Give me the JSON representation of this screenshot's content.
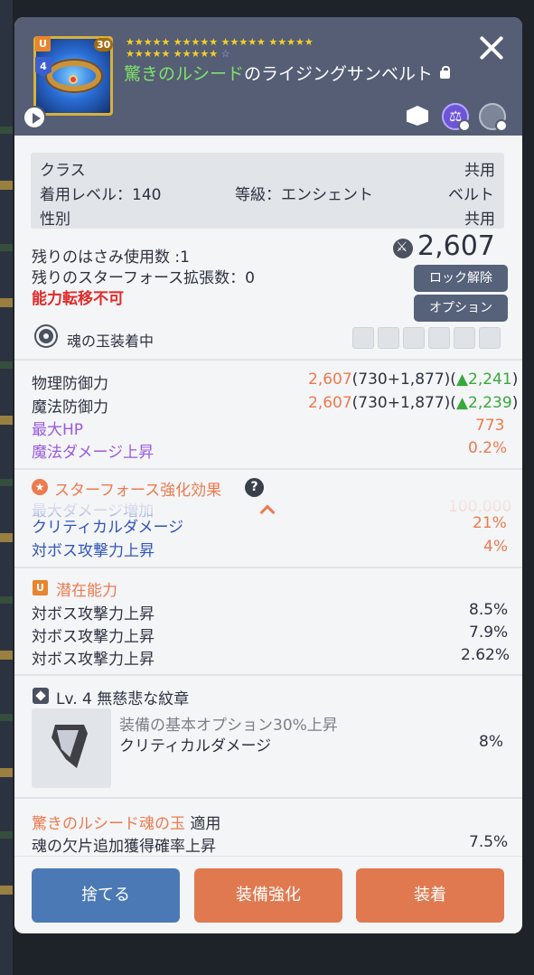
{
  "item": {
    "title_prefix": "驚きのルシード",
    "title_suffix": "のライジングサンベルト",
    "stars_filled": "★★★★★ ★★★★★ ★★★★★ ★★★★★",
    "stars_row2": "★★★★★ ★★★★★",
    "star_empty": "☆",
    "badge_rank": "U",
    "badge_level": "4",
    "badge_count": "30"
  },
  "info": {
    "class_label": "クラス",
    "class_value": "共用",
    "level_label": "着用レベル：140",
    "grade_label": "等級：エンシェント",
    "type_value": "ベルト",
    "gender_label": "性別",
    "gender_value": "共用"
  },
  "status": {
    "scissors": "残りのはさみ使用数 :1",
    "starforce_ext": "残りのスターフォース拡張数：0",
    "transfer": "能力転移不可",
    "attack_power": "2,607",
    "unlock_btn": "ロック解除",
    "option_btn": "オプション",
    "soul_equipped": "魂の玉装着中"
  },
  "stats": [
    {
      "name": "物理防御力",
      "value": "2,607",
      "detail": "(730+1,877)(",
      "up": "▲2,241",
      "close": ")",
      "style": "normal"
    },
    {
      "name": "魔法防御力",
      "value": "2,607",
      "detail": "(730+1,877)(",
      "up": "▲2,239",
      "close": ")",
      "style": "normal"
    },
    {
      "name": "最大HP",
      "value": "773",
      "style": "purple"
    },
    {
      "name": "魔法ダメージ上昇",
      "value": "0.2%",
      "style": "purple"
    }
  ],
  "starforce": {
    "title": "スターフォース強化効果",
    "help": "?",
    "partial": "最大ダメージ増加",
    "partial_value": "100,000",
    "rows": [
      {
        "name": "クリティカルダメージ",
        "value": "21%"
      },
      {
        "name": "対ボス攻撃力上昇",
        "value": "4%"
      }
    ]
  },
  "potential": {
    "title": "潜在能力",
    "badge": "U",
    "rows": [
      {
        "name": "対ボス攻撃力上昇",
        "value": "8.5%"
      },
      {
        "name": "対ボス攻撃力上昇",
        "value": "7.9%"
      },
      {
        "name": "対ボス攻撃力上昇",
        "value": "2.62%"
      }
    ]
  },
  "emblem": {
    "title": "Lv. 4 無慈悲な紋章",
    "line1": "装備の基本オプション30%上昇",
    "line2": "クリティカルダメージ",
    "value": "8%"
  },
  "soul": {
    "name": "驚きのルシード魂の玉",
    "applied": "適用",
    "effect": "魂の欠片追加獲得確率上昇",
    "effect_value": "7.5%"
  },
  "buttons": {
    "discard": "捨てる",
    "enhance": "装備強化",
    "equip": "装着"
  },
  "colors": {
    "header_bg": "#555e74",
    "accent_orange": "#e07950",
    "discard_blue": "#4a79b5",
    "title_green": "#7fe36a",
    "purple": "#9a5adf"
  }
}
